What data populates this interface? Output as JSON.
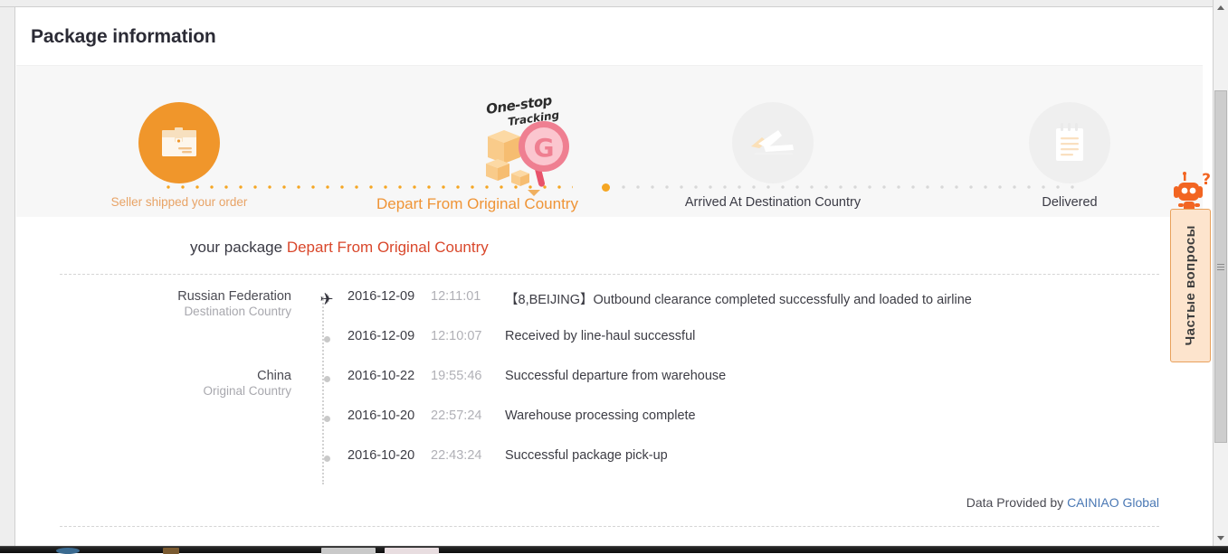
{
  "header": {
    "title": "Package information"
  },
  "stepper": {
    "steps": [
      {
        "label": "Seller shipped your order",
        "icon": "package-box-icon",
        "state": "done"
      },
      {
        "label": "Depart From Original Country",
        "icon": "one-stop-tracking-icon",
        "state": "current"
      },
      {
        "label": "Arrived At Destination Country",
        "icon": "airplane-icon",
        "state": "pending"
      },
      {
        "label": "Delivered",
        "icon": "notepad-icon",
        "state": "pending"
      }
    ],
    "badge": {
      "line1": "One-stop",
      "line2": "Tracking"
    },
    "colors": {
      "active_orange": "#f0962b",
      "track_orange": "#f5a623",
      "track_gray": "#d8d8d8",
      "pending_gray": "#efefef"
    }
  },
  "package_status": {
    "prefix": "your package",
    "status": "Depart From Original Country",
    "status_color": "#d9472b"
  },
  "tracking": {
    "rows": [
      {
        "country": "Russian Federation",
        "role": "Destination Country",
        "marker": "airplane-icon",
        "date": "2016-12-09",
        "time": "12:11:01",
        "message": "【8,BEIJING】Outbound clearance completed successfully and loaded to airline"
      },
      {
        "country": "",
        "role": "",
        "marker": "dot-icon",
        "date": "2016-12-09",
        "time": "12:10:07",
        "message": "Received by line-haul successful"
      },
      {
        "country": "China",
        "role": "Original Country",
        "marker": "dot-icon",
        "date": "2016-10-22",
        "time": "19:55:46",
        "message": "Successful departure from warehouse"
      },
      {
        "country": "",
        "role": "",
        "marker": "dot-icon",
        "date": "2016-10-20",
        "time": "22:57:24",
        "message": "Warehouse processing complete"
      },
      {
        "country": "",
        "role": "",
        "marker": "dot-icon",
        "date": "2016-10-20",
        "time": "22:43:24",
        "message": "Successful package pick-up"
      }
    ]
  },
  "provider": {
    "prefix": "Data Provided by",
    "name": "CAINIAO Global",
    "link_color": "#4a78b4"
  },
  "help_widget": {
    "label": "Частые вопросы",
    "icon": "robot-question-icon",
    "bg_color": "#fde4cd",
    "border_color": "#e8a15c"
  },
  "scrollbar": {
    "up_icon": "scroll-up-arrow-icon",
    "down_icon": "scroll-down-arrow-icon"
  }
}
